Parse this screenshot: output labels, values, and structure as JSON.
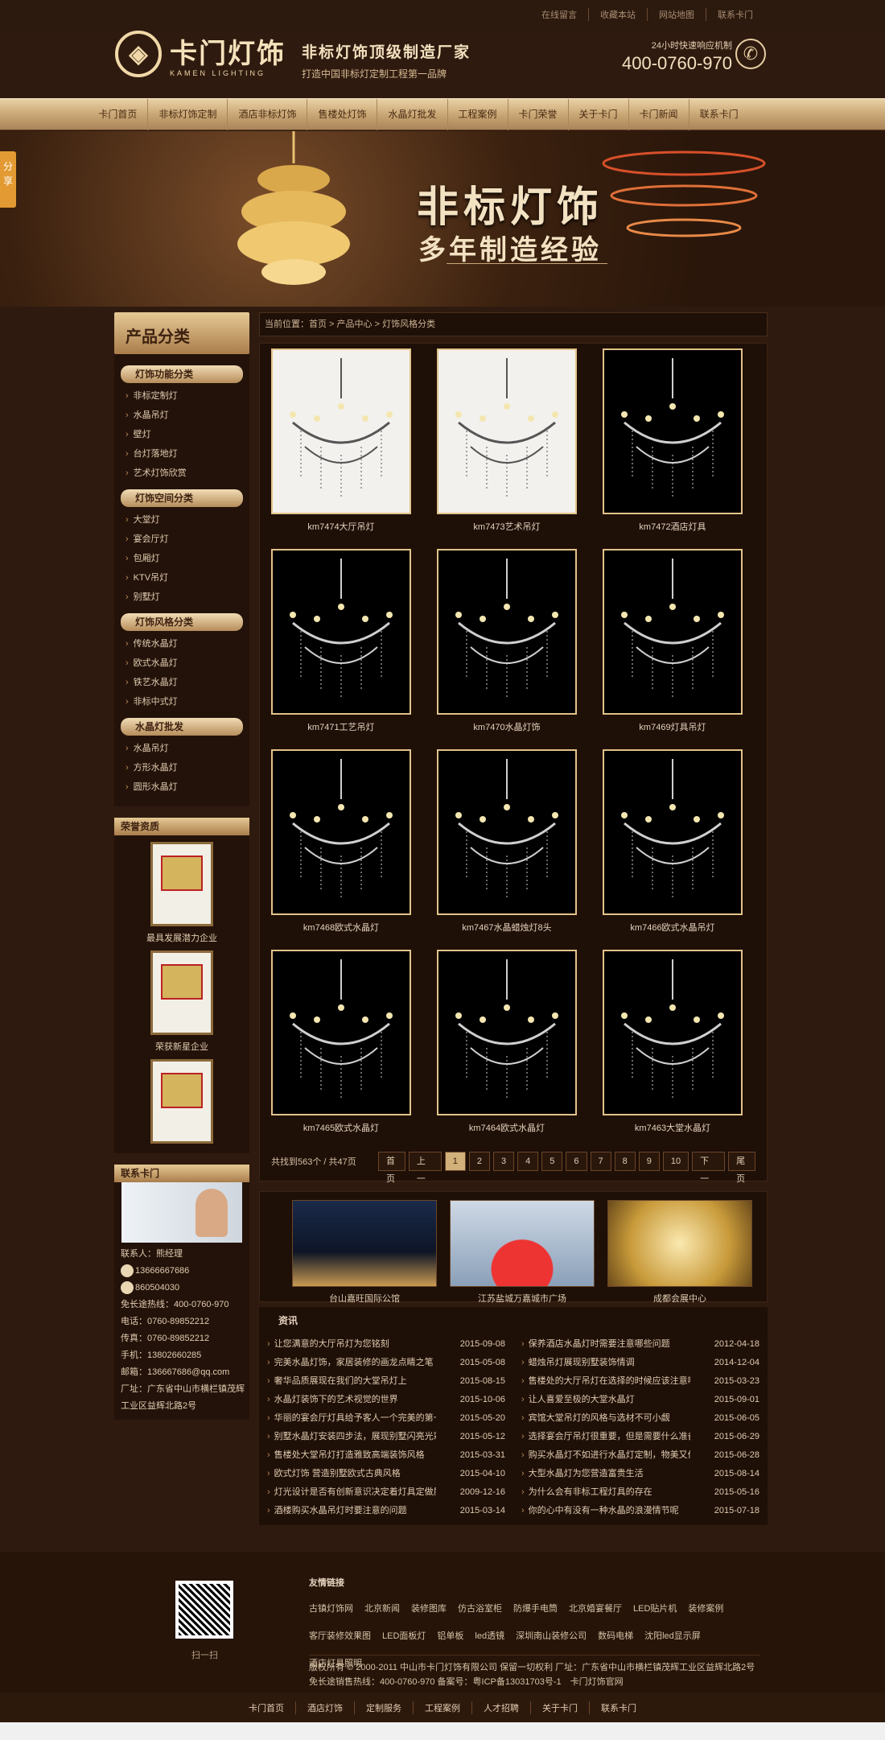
{
  "topbar": {
    "links": [
      "在线留言",
      "收藏本站",
      "网站地图",
      "联系卡门"
    ]
  },
  "brand": {
    "logo_cn": "卡门灯饰",
    "logo_en": "KAMEN LIGHTING",
    "slogan_1": "非标灯饰顶级制造厂家",
    "slogan_2": "打造中国非标灯定制工程第一品牌",
    "hotline_label": "24小时快速响应机制",
    "hotline": "400-0760-970"
  },
  "nav": [
    "卡门首页",
    "非标灯饰定制",
    "酒店非标灯饰",
    "售楼处灯饰",
    "水晶灯批发",
    "工程案例",
    "卡门荣誉",
    "关于卡门",
    "卡门新闻",
    "联系卡门"
  ],
  "share": "分享",
  "banner": {
    "title": "非标灯饰",
    "subtitle": "多年制造经验"
  },
  "sidebar": {
    "title": "产品分类",
    "groups": [
      {
        "name": "灯饰功能分类",
        "items": [
          "非标定制灯",
          "水晶吊灯",
          "壁灯",
          "台灯落地灯",
          "艺术灯饰欣赏"
        ]
      },
      {
        "name": "灯饰空间分类",
        "items": [
          "大堂灯",
          "宴会厅灯",
          "包厢灯",
          "KTV吊灯",
          "别墅灯"
        ]
      },
      {
        "name": "灯饰风格分类",
        "items": [
          "传统水晶灯",
          "欧式水晶灯",
          "铁艺水晶灯",
          "非标中式灯"
        ]
      },
      {
        "name": "水晶灯批发",
        "items": [
          "水晶吊灯",
          "方形水晶灯",
          "圆形水晶灯"
        ]
      }
    ],
    "honor_title": "荣誉资质",
    "honors": [
      "最具发展潜力企业",
      "荣获新星企业",
      ""
    ],
    "contact_title": "联系卡门",
    "contact": [
      "联系人：熊经理",
      "13666667686",
      "860504030",
      "免长途热线：400-0760-970",
      "电话：0760-89852212",
      "传真：0760-89852212",
      "手机：13802660285",
      "邮箱：136667686@qq.com",
      "厂址：广东省中山市横栏镇茂辉工业区益辉北路2号"
    ]
  },
  "breadcrumb": "当前位置：首页 > 产品中心 > 灯饰风格分类",
  "products": [
    {
      "name": "km7474大厅吊灯",
      "bg": "light"
    },
    {
      "name": "km7473艺术吊灯",
      "bg": "light"
    },
    {
      "name": "km7472酒店灯具",
      "bg": "dark"
    },
    {
      "name": "km7471工艺吊灯",
      "bg": "dark"
    },
    {
      "name": "km7470水晶灯饰",
      "bg": "dark"
    },
    {
      "name": "km7469灯具吊灯",
      "bg": "dark"
    },
    {
      "name": "km7468欧式水晶灯",
      "bg": "dark"
    },
    {
      "name": "km7467水晶蜡烛灯8头",
      "bg": "dark"
    },
    {
      "name": "km7466欧式水晶吊灯",
      "bg": "dark"
    },
    {
      "name": "km7465欧式水晶灯",
      "bg": "dark"
    },
    {
      "name": "km7464欧式水晶灯",
      "bg": "dark"
    },
    {
      "name": "km7463大堂水晶灯",
      "bg": "dark"
    }
  ],
  "pager": {
    "count": "共找到563个 / 共47页",
    "buttons": [
      "首页",
      "上一页",
      "1",
      "2",
      "3",
      "4",
      "5",
      "6",
      "7",
      "8",
      "9",
      "10",
      "下一页",
      "尾页"
    ],
    "current": "1"
  },
  "cases": [
    "台山嘉旺国际公馆",
    "江苏盐城万嘉城市广场",
    "成都会展中心"
  ],
  "news_title": "资讯",
  "news_left": [
    [
      "让您满意的大厅吊灯为您铭刻",
      "2015-09-08"
    ],
    [
      "完美水晶灯饰，家居装修的画龙点睛之笔",
      "2015-05-08"
    ],
    [
      "奢华品质展现在我们的大堂吊灯上",
      "2015-08-15"
    ],
    [
      "水晶灯装饰下的艺术视觉的世界",
      "2015-10-06"
    ],
    [
      "华丽的宴会厅灯具给予客人一个完美的第一印象",
      "2015-05-20"
    ],
    [
      "别墅水晶灯安装四步法，展现别墅闪亮光彩",
      "2015-05-12"
    ],
    [
      "售楼处大堂吊灯打造雅致高端装饰风格",
      "2015-03-31"
    ],
    [
      "欧式灯饰 营造别墅欧式古典风格",
      "2015-04-10"
    ],
    [
      "灯光设计是否有创新意识决定着灯具定做质量优劣",
      "2009-12-16"
    ],
    [
      "酒楼购买水晶吊灯时要注意的问题",
      "2015-03-14"
    ]
  ],
  "news_right": [
    [
      "保养酒店水晶灯时需要注意哪些问题",
      "2012-04-18"
    ],
    [
      "蜡烛吊灯展现别墅装饰情调",
      "2014-12-04"
    ],
    [
      "售楼处的大厅吊灯在选择的时候应该注意哪些问题",
      "2015-03-23"
    ],
    [
      "让人喜爱至极的大堂水晶灯",
      "2015-09-01"
    ],
    [
      "宾馆大堂吊灯的风格与选材不可小觑",
      "2015-06-05"
    ],
    [
      "选择宴会厅吊灯很重要，但是需要什么准备才可以",
      "2015-06-29"
    ],
    [
      "购买水晶灯不如进行水晶灯定制，物美又价廉",
      "2015-06-28"
    ],
    [
      "大型水晶灯为您营造富贵生活",
      "2015-08-14"
    ],
    [
      "为什么会有非标工程灯具的存在",
      "2015-05-16"
    ],
    [
      "你的心中有没有一种水晶的浪漫情节呢",
      "2015-07-18"
    ]
  ],
  "footer": {
    "qr_label": "扫一扫",
    "links_title": "友情链接",
    "links": [
      "古镇灯饰网",
      "北京新闻",
      "装修图库",
      "仿古浴室柜",
      "防爆手电筒",
      "北京婚宴餐厅",
      "LED贴片机",
      "装修案例",
      "客厅装修效果图",
      "LED面板灯",
      "铝单板",
      "led透镜",
      "深圳南山装修公司",
      "数码电梯",
      "沈阳led显示屏",
      "酒店灯具照明"
    ],
    "copyright": "版权所有 © 2000-2011 中山市卡门灯饰有限公司 保留一切权利 厂址：广东省中山市横栏镇茂辉工业区益辉北路2号",
    "icp": "免长途销售热线：400-0760-970 备案号：粤ICP备13031703号-1　卡门灯饰官网"
  },
  "bottom_nav": [
    "卡门首页",
    "酒店灯饰",
    "定制服务",
    "工程案例",
    "人才招聘",
    "关于卡门",
    "联系卡门"
  ]
}
